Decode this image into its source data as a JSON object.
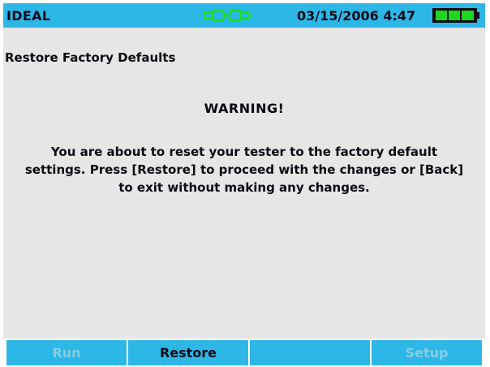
{
  "status_bar": {
    "brand": "IDEAL",
    "connection_icon": "link-icon",
    "datetime": "03/15/2006 4:47",
    "battery_icon": "battery-full-icon",
    "colors": {
      "bar": "#2db7e6",
      "battery_fill": "#1fd61f"
    }
  },
  "page": {
    "title": "Restore Factory Defaults",
    "warning_heading": "WARNING!",
    "warning_lines": [
      "You are about to reset your tester to the factory default",
      "settings. Press [Restore] to proceed with the changes or [Back]",
      "to exit without making any changes."
    ]
  },
  "softkeys": [
    {
      "label": "Run",
      "enabled": false
    },
    {
      "label": "Restore",
      "enabled": true
    },
    {
      "label": "",
      "enabled": false
    },
    {
      "label": "Setup",
      "enabled": false
    }
  ]
}
